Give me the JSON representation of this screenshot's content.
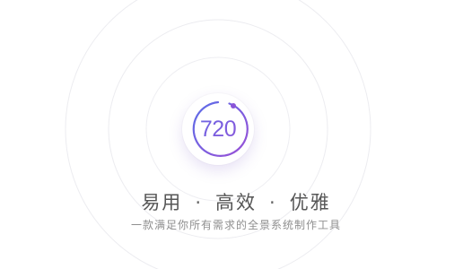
{
  "logo": {
    "text": "720",
    "icon": "720-logo-icon",
    "gradient_start": "#5b6ee8",
    "gradient_end": "#9a4fd6"
  },
  "headline": {
    "part1": "易用",
    "part2": "高效",
    "part3": "优雅",
    "separator": "·"
  },
  "subline": "一款满足你所有需求的全景系统制作工具",
  "colors": {
    "ring": "#e9e9ee",
    "headline": "#555555",
    "subline": "#8f8f8f"
  }
}
